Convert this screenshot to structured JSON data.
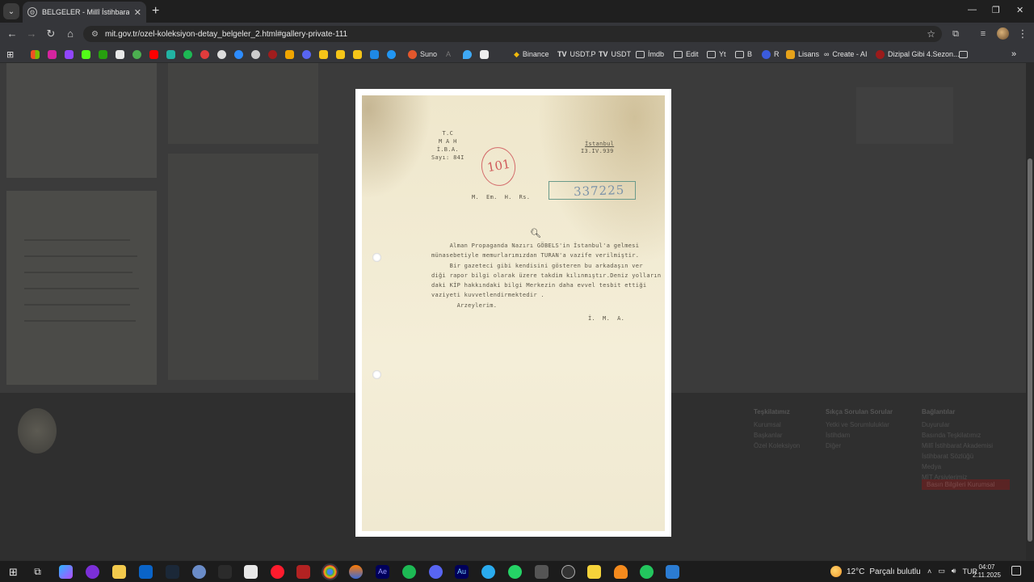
{
  "browser": {
    "tab_title": "BELGELER - Millî İstihbarat Teşki",
    "url": "mit.gov.tr/ozel-koleksiyon-detay_belgeler_2.html#gallery-private-111",
    "bookmarks": [
      {
        "label": "Suno",
        "icon": "suno-icon",
        "color": "#e3572c"
      },
      {
        "label": "Binance",
        "icon": "binance-icon",
        "color": "#f0b90b"
      },
      {
        "label": "USDT.P",
        "icon": "tv-icon",
        "color": "#e3e3e3"
      },
      {
        "label": "USDT",
        "icon": "tv-icon",
        "color": "#e3e3e3"
      },
      {
        "label": "İmdb",
        "icon": "folder-icon",
        "color": "#cfcfcf"
      },
      {
        "label": "Edit",
        "icon": "folder-icon",
        "color": "#cfcfcf"
      },
      {
        "label": "Yt",
        "icon": "folder-icon",
        "color": "#cfcfcf"
      },
      {
        "label": "B",
        "icon": "folder-icon",
        "color": "#cfcfcf"
      },
      {
        "label": "R",
        "icon": "r-icon",
        "color": "#3b5bdb"
      },
      {
        "label": "Lisans",
        "icon": "s-icon",
        "color": "#e6a21a"
      },
      {
        "label": "Create - AI",
        "icon": "infinity-icon",
        "color": "#e3e3e3"
      },
      {
        "label": "Dizipal Gibi 4.Sezon...",
        "icon": "dizipal-icon",
        "color": "#9a1b1b"
      }
    ]
  },
  "document": {
    "header_left": "T.C\nM A H\nİ.B.A.\nSayı: 84I",
    "place": "İstanbul",
    "date": "I3.IV.939",
    "stamp_red": "101",
    "stamp_box": "337225",
    "recipient": "M.  Em.  H.  Rs.",
    "body": "     Alman Propaganda Nazırı GÖBELS'in İstanbul'a gelmesi\nmünasebetiyle memurlarımızdan TURAN'a vazife verilmiştir.\n     Bir gazeteci gibi kendisini gösteren bu arkadaşın ver\ndiği rapor bilgi olarak üzere takdim kılınmıştır.Deniz yolların\ndaki KİP hakkındaki bilgi Merkezin daha evvel tesbit ettiği\nvaziyeti kuvvetlendirmektedir .\n       Arzeylerim.",
    "signature": "İ.  M.  A."
  },
  "taskbar": {
    "weather_temp": "12°C",
    "weather_text": "Parçalı bulutlu",
    "language": "TUR",
    "time": "04:07",
    "date": "2.11.2025"
  },
  "footer": {
    "col1_title": "Teşkilatımız",
    "col1_items": [
      "Kurumsal",
      "Başkanlar",
      "Özel Koleksiyon"
    ],
    "col2_title": "Sıkça Sorulan Sorular",
    "col2_items": [
      "Yetki ve Sorumluluklar",
      "İstihdam",
      "Diğer"
    ],
    "col3_title": "Bağlantılar",
    "col3_items": [
      "Duyurular",
      "Basında Teşkilatımız",
      "Millî İstihbarat Akademisi",
      "İstihbarat Sözlüğü",
      "Medya",
      "MİT Arşivlerimiz"
    ],
    "red_link": "Basın Bilgileri Kurumsal"
  }
}
